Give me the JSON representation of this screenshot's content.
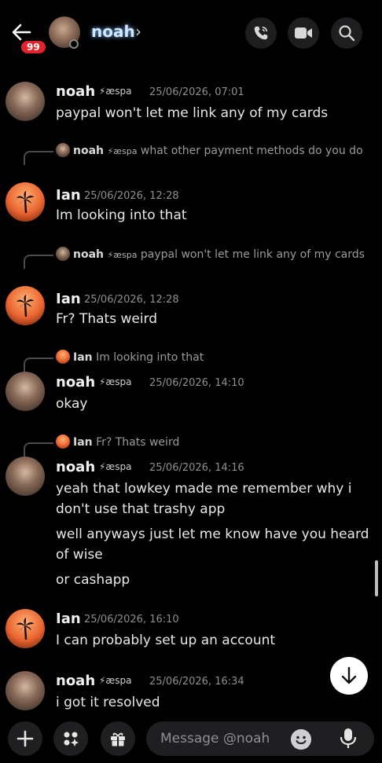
{
  "header": {
    "unread_badge": "99",
    "contact_name": "noah",
    "chevron": "›"
  },
  "messages": [
    {
      "author": "noah",
      "tag": "⚡æspa",
      "time": "25/06/2026, 07:01",
      "lines": [
        "paypal won't let me link any of my cards"
      ]
    },
    {
      "reply_to": {
        "author": "noah",
        "tag": "⚡æspa",
        "text": "what other payment methods do you do"
      },
      "author": "Ian",
      "time": "25/06/2026, 12:28",
      "lines": [
        "Im looking into that"
      ]
    },
    {
      "reply_to": {
        "author": "noah",
        "tag": "⚡æspa",
        "text": "paypal won't let me link any of my cards"
      },
      "author": "Ian",
      "time": "25/06/2026, 12:28",
      "lines": [
        "Fr? Thats weird"
      ]
    },
    {
      "reply_to": {
        "author": "Ian",
        "text": "Im looking into that"
      },
      "author": "noah",
      "tag": "⚡æspa",
      "time": "25/06/2026, 14:10",
      "lines": [
        "okay"
      ]
    },
    {
      "reply_to": {
        "author": "Ian",
        "text": "Fr? Thats weird"
      },
      "author": "noah",
      "tag": "⚡æspa",
      "time": "25/06/2026, 14:16",
      "lines": [
        "yeah that lowkey made me remember why i don't use that trashy app",
        "well anyways just let me know have you heard of wise",
        "or cashapp"
      ]
    },
    {
      "author": "Ian",
      "time": "25/06/2026, 16:10",
      "lines": [
        "I can probably set up an account"
      ]
    },
    {
      "author": "noah",
      "tag": "⚡æspa",
      "time": "25/06/2026, 16:34",
      "lines": [
        "i got it resolved"
      ]
    }
  ],
  "composer": {
    "placeholder": "Message @noah"
  }
}
